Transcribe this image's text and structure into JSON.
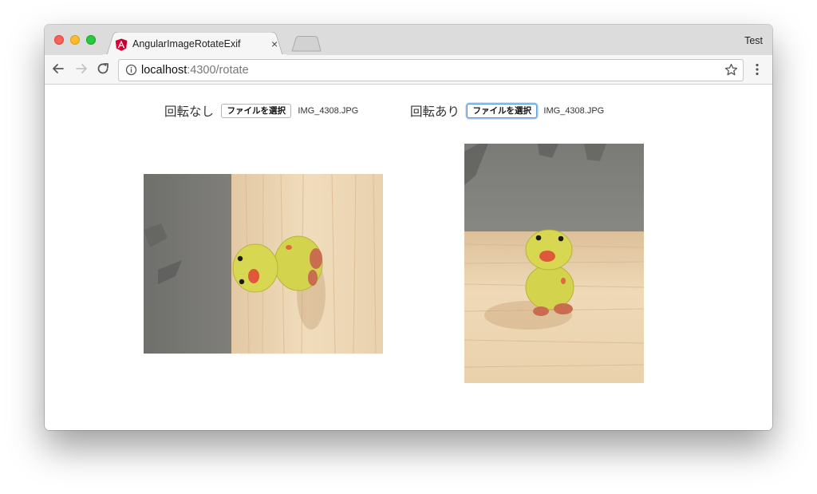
{
  "browser": {
    "tab_title": "AngularImageRotateExif",
    "tab_close": "×",
    "profile_name": "Test",
    "url_host": "localhost",
    "url_rest": ":4300/rotate",
    "angular_red": "#dd0031"
  },
  "uploads": [
    {
      "label": "回転なし",
      "button": "ファイルを選択",
      "filename": "IMG_4308.JPG"
    },
    {
      "label": "回転あり",
      "button": "ファイルを選択",
      "filename": "IMG_4308.JPG"
    }
  ],
  "images": [
    {
      "name": "photo-without-rotation",
      "orientation": "landscape"
    },
    {
      "name": "photo-with-rotation",
      "orientation": "portrait"
    }
  ]
}
